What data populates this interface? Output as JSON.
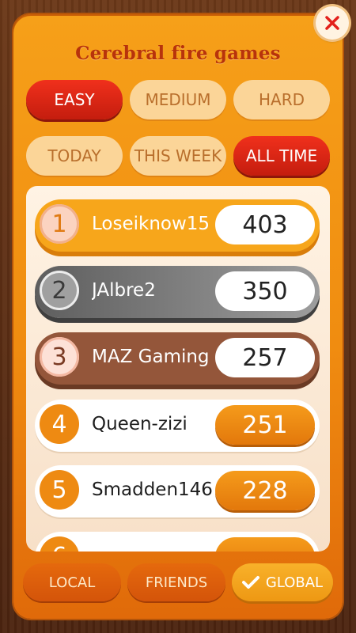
{
  "header": {
    "title": "Cerebral fire games",
    "close_label": "X"
  },
  "difficulty_tabs": [
    {
      "label": "EASY",
      "active": true
    },
    {
      "label": "MEDIUM",
      "active": false
    },
    {
      "label": "HARD",
      "active": false
    }
  ],
  "period_tabs": [
    {
      "label": "TODAY",
      "active": false
    },
    {
      "label": "THIS WEEK",
      "active": false
    },
    {
      "label": "ALL TIME",
      "active": true
    }
  ],
  "leaderboard": [
    {
      "rank": "1",
      "name": "Loseiknow15",
      "score": "403",
      "tier": "gold"
    },
    {
      "rank": "2",
      "name": "JAlbre2",
      "score": "350",
      "tier": "silver"
    },
    {
      "rank": "3",
      "name": "MAZ Gaming",
      "score": "257",
      "tier": "bronze"
    },
    {
      "rank": "4",
      "name": "Queen-zizi",
      "score": "251",
      "tier": "normal"
    },
    {
      "rank": "5",
      "name": "Smadden146",
      "score": "228",
      "tier": "normal"
    },
    {
      "rank": "6",
      "name": "",
      "score": "",
      "tier": "normal"
    }
  ],
  "scope_tabs": [
    {
      "label": "LOCAL",
      "active": false
    },
    {
      "label": "FRIENDS",
      "active": false
    },
    {
      "label": "GLOBAL",
      "active": true,
      "icon": "check-icon"
    }
  ],
  "colors": {
    "accent_red": "#d4200f",
    "panel_orange": "#f39a16",
    "title": "#b8330b"
  }
}
